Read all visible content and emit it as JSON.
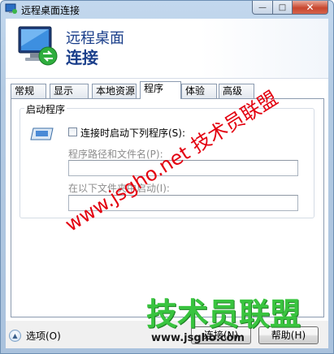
{
  "window": {
    "title": "远程桌面连接",
    "controls": {
      "minimize": "—",
      "maximize": "□",
      "close": "✕"
    }
  },
  "banner": {
    "line1": "远程桌面",
    "line2": "连接"
  },
  "tabs": [
    {
      "label": "常规"
    },
    {
      "label": "显示"
    },
    {
      "label": "本地资源"
    },
    {
      "label": "程序",
      "active": true
    },
    {
      "label": "体验"
    },
    {
      "label": "高级"
    }
  ],
  "program": {
    "group_title": "启动程序",
    "checkbox_label": "连接时启动下列程序(S):",
    "checked": false,
    "path_label": "程序路径和文件名(P):",
    "path_value": "",
    "folder_label": "在以下文件夹中启动(I):",
    "folder_value": ""
  },
  "footer": {
    "options_label": "选项(O)",
    "connect_label": "连接(N)",
    "help_label": "帮助(H)"
  },
  "watermarks": {
    "diagonal": "www.jsgho.net 技术员联盟",
    "big": "技术员联盟",
    "url": "www.jsgho.com"
  },
  "colors": {
    "accent": "#1a3e8a",
    "window_frame": "#aac2dd",
    "watermark_red": "#e3000f",
    "watermark_green": "#39c43f"
  }
}
